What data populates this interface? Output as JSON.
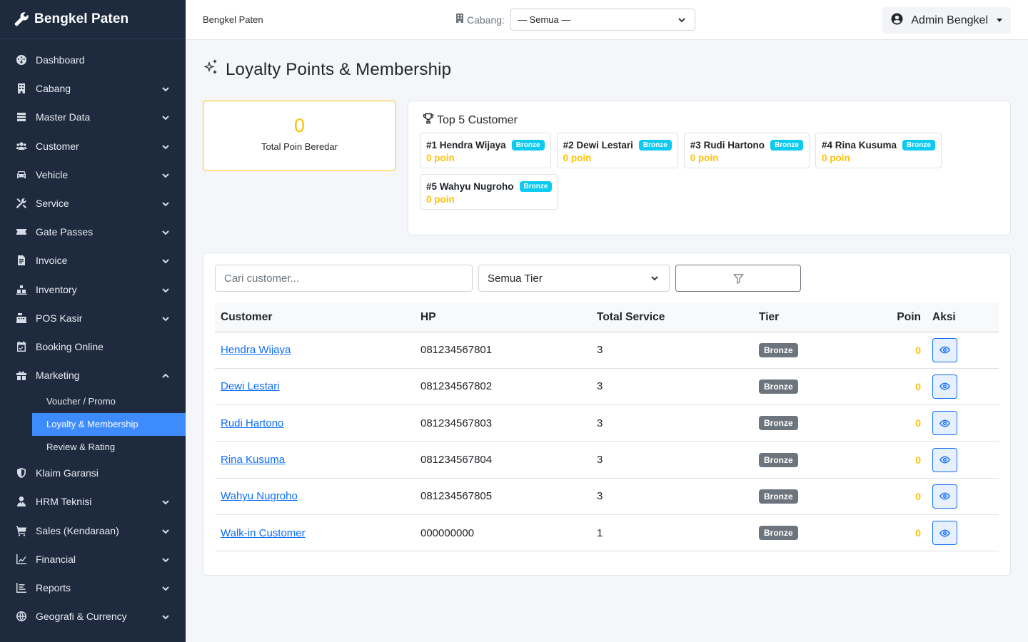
{
  "app": {
    "brand": "Bengkel Paten"
  },
  "topbar": {
    "title": "Bengkel Paten",
    "branch_label": "Cabang:",
    "branch_value": "— Semua —",
    "user_name": "Admin Bengkel"
  },
  "sidebar": {
    "items": [
      {
        "label": "Dashboard",
        "icon": "dashboard-icon"
      },
      {
        "label": "Cabang",
        "icon": "building-icon"
      },
      {
        "label": "Master Data",
        "icon": "database-icon"
      },
      {
        "label": "Customer",
        "icon": "users-icon"
      },
      {
        "label": "Vehicle",
        "icon": "car-icon"
      },
      {
        "label": "Service",
        "icon": "tools-icon"
      },
      {
        "label": "Gate Passes",
        "icon": "ticket-icon"
      },
      {
        "label": "Invoice",
        "icon": "invoice-icon"
      },
      {
        "label": "Inventory",
        "icon": "inventory-icon"
      },
      {
        "label": "POS Kasir",
        "icon": "cash-register-icon"
      },
      {
        "label": "Booking Online",
        "icon": "calendar-icon"
      },
      {
        "label": "Marketing",
        "icon": "gift-icon"
      },
      {
        "label": "Klaim Garansi",
        "icon": "shield-icon"
      },
      {
        "label": "HRM Teknisi",
        "icon": "user-tie-icon"
      },
      {
        "label": "Sales (Kendaraan)",
        "icon": "cart-icon"
      },
      {
        "label": "Financial",
        "icon": "line-chart-icon"
      },
      {
        "label": "Reports",
        "icon": "report-icon"
      },
      {
        "label": "Geografi & Currency",
        "icon": "globe-icon"
      }
    ],
    "marketing_sub": [
      {
        "label": "Voucher / Promo"
      },
      {
        "label": "Loyalty & Membership"
      },
      {
        "label": "Review & Rating"
      }
    ]
  },
  "page": {
    "title": "Loyalty Points & Membership"
  },
  "summary": {
    "total_points": "0",
    "total_points_label": "Total Poin Beredar"
  },
  "top5": {
    "title": "Top 5 Customer",
    "items": [
      {
        "rank_name": "#1 Hendra Wijaya",
        "tier": "Bronze",
        "points": "0 poin"
      },
      {
        "rank_name": "#2 Dewi Lestari",
        "tier": "Bronze",
        "points": "0 poin"
      },
      {
        "rank_name": "#3 Rudi Hartono",
        "tier": "Bronze",
        "points": "0 poin"
      },
      {
        "rank_name": "#4 Rina Kusuma",
        "tier": "Bronze",
        "points": "0 poin"
      },
      {
        "rank_name": "#5 Wahyu Nugroho",
        "tier": "Bronze",
        "points": "0 poin"
      }
    ]
  },
  "filters": {
    "search_placeholder": "Cari customer...",
    "tier_value": "Semua Tier"
  },
  "table": {
    "headers": {
      "customer": "Customer",
      "hp": "HP",
      "total_service": "Total Service",
      "tier": "Tier",
      "poin": "Poin",
      "aksi": "Aksi"
    },
    "rows": [
      {
        "customer": "Hendra Wijaya",
        "hp": "081234567801",
        "total_service": "3",
        "tier": "Bronze",
        "poin": "0"
      },
      {
        "customer": "Dewi Lestari",
        "hp": "081234567802",
        "total_service": "3",
        "tier": "Bronze",
        "poin": "0"
      },
      {
        "customer": "Rudi Hartono",
        "hp": "081234567803",
        "total_service": "3",
        "tier": "Bronze",
        "poin": "0"
      },
      {
        "customer": "Rina Kusuma",
        "hp": "081234567804",
        "total_service": "3",
        "tier": "Bronze",
        "poin": "0"
      },
      {
        "customer": "Wahyu Nugroho",
        "hp": "081234567805",
        "total_service": "3",
        "tier": "Bronze",
        "poin": "0"
      },
      {
        "customer": "Walk-in Customer",
        "hp": "000000000",
        "total_service": "1",
        "tier": "Bronze",
        "poin": "0"
      }
    ]
  },
  "colors": {
    "sidebar_bg": "#1e2a3e",
    "active": "#3d8bfd",
    "warning": "#ffc107",
    "info": "#0dcaf0",
    "primary": "#0d6efd"
  }
}
